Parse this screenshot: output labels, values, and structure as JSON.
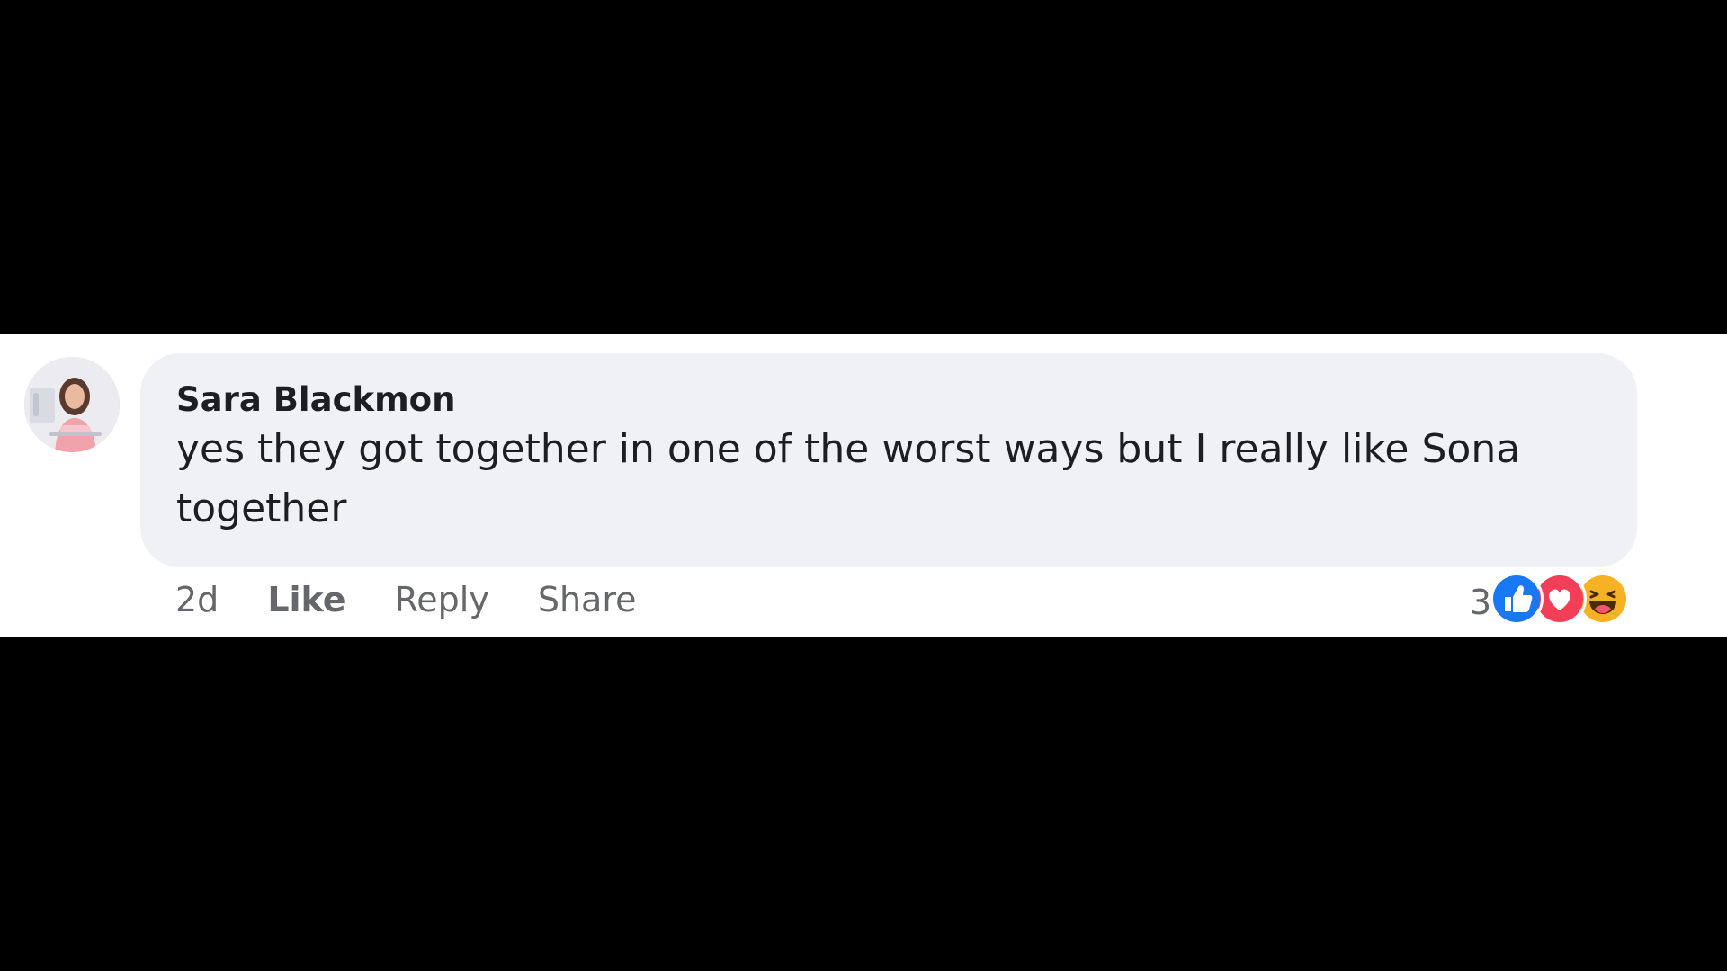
{
  "comment": {
    "author": "Sara Blackmon",
    "text": "yes they got together in one of the worst ways but I really like Sona together",
    "avatar_icon": "user-avatar"
  },
  "actions": {
    "timestamp": "2d",
    "like_label": "Like",
    "reply_label": "Reply",
    "share_label": "Share"
  },
  "reactions": {
    "count": "3",
    "icons": [
      "like-reaction-icon",
      "love-reaction-icon",
      "haha-reaction-icon"
    ]
  },
  "colors": {
    "bubble_bg": "#f0f1f5",
    "text": "#1c1e21",
    "secondary_text": "#65676b",
    "like_blue": "#1877f2",
    "love_red": "#f33e58",
    "haha_yellow": "#f7b125",
    "letterbox": "#000000"
  }
}
